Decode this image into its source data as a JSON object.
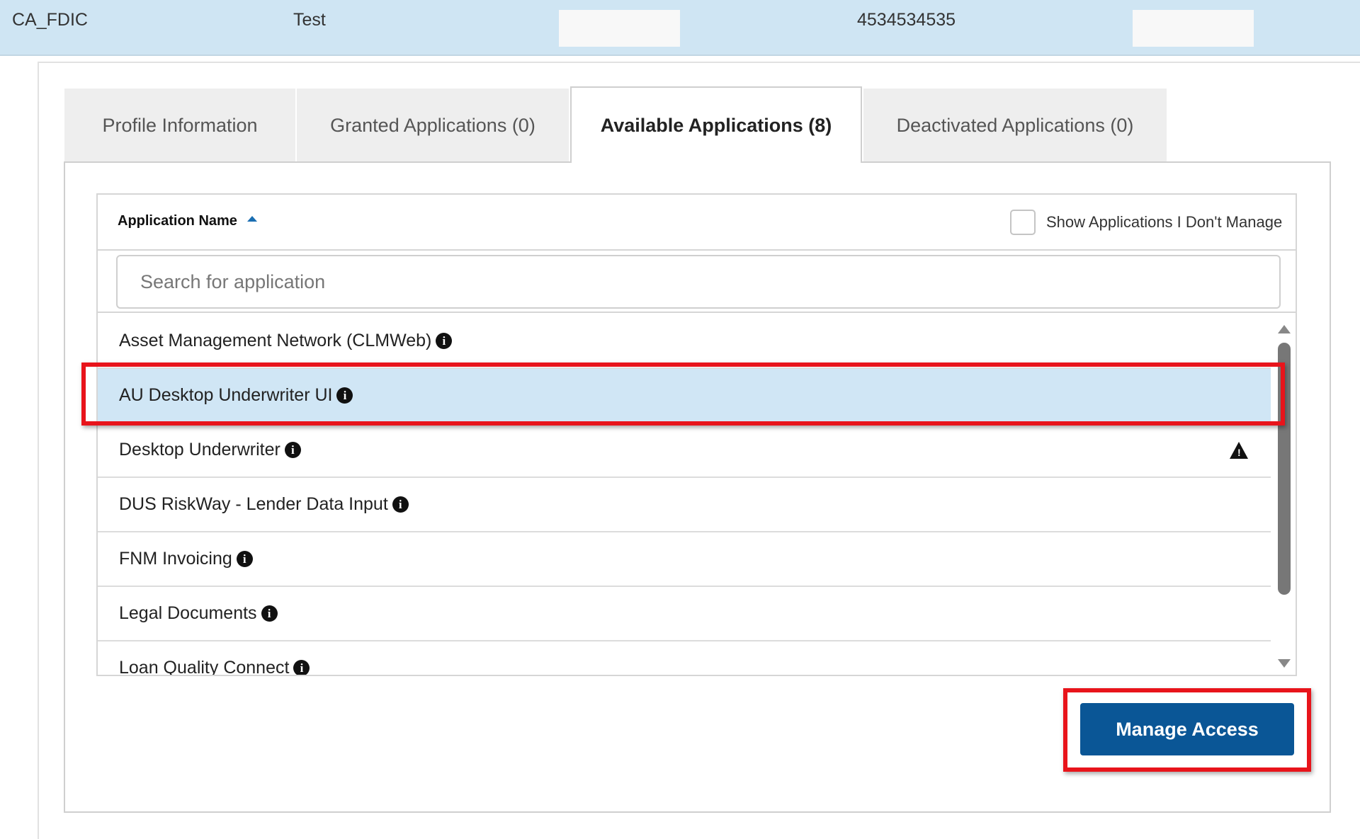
{
  "header_row": {
    "cells": [
      "CA_FDIC",
      "Test",
      "4534534535"
    ]
  },
  "tabs": [
    {
      "label": "Profile Information",
      "active": false
    },
    {
      "label": "Granted Applications (0)",
      "active": false
    },
    {
      "label": "Available Applications (8)",
      "active": true
    },
    {
      "label": "Deactivated Applications (0)",
      "active": false
    }
  ],
  "grid": {
    "column_title": "Application Name",
    "show_unmanaged_label": "Show Applications I Don't Manage",
    "show_unmanaged_checked": false,
    "search_placeholder": "Search for application",
    "rows": [
      {
        "name": "Asset Management Network (CLMWeb)",
        "selected": false,
        "warning": false
      },
      {
        "name": "AU Desktop Underwriter UI",
        "selected": true,
        "warning": false
      },
      {
        "name": "Desktop Underwriter",
        "selected": false,
        "warning": true
      },
      {
        "name": "DUS RiskWay - Lender Data Input",
        "selected": false,
        "warning": false
      },
      {
        "name": "FNM Invoicing",
        "selected": false,
        "warning": false
      },
      {
        "name": "Legal Documents",
        "selected": false,
        "warning": false
      },
      {
        "name": "Loan Quality Connect",
        "selected": false,
        "warning": false
      }
    ]
  },
  "actions": {
    "manage_access_label": "Manage Access"
  },
  "colors": {
    "header_bg": "#cfe5f3",
    "selected_row_bg": "#d0e6f5",
    "primary_button": "#0a5696",
    "highlight_box": "#e8141b",
    "sort_arrow": "#1a6eb2"
  },
  "icons": {
    "info": "info-circle-icon",
    "warning": "warning-triangle-icon",
    "sort": "sort-ascending-icon"
  }
}
